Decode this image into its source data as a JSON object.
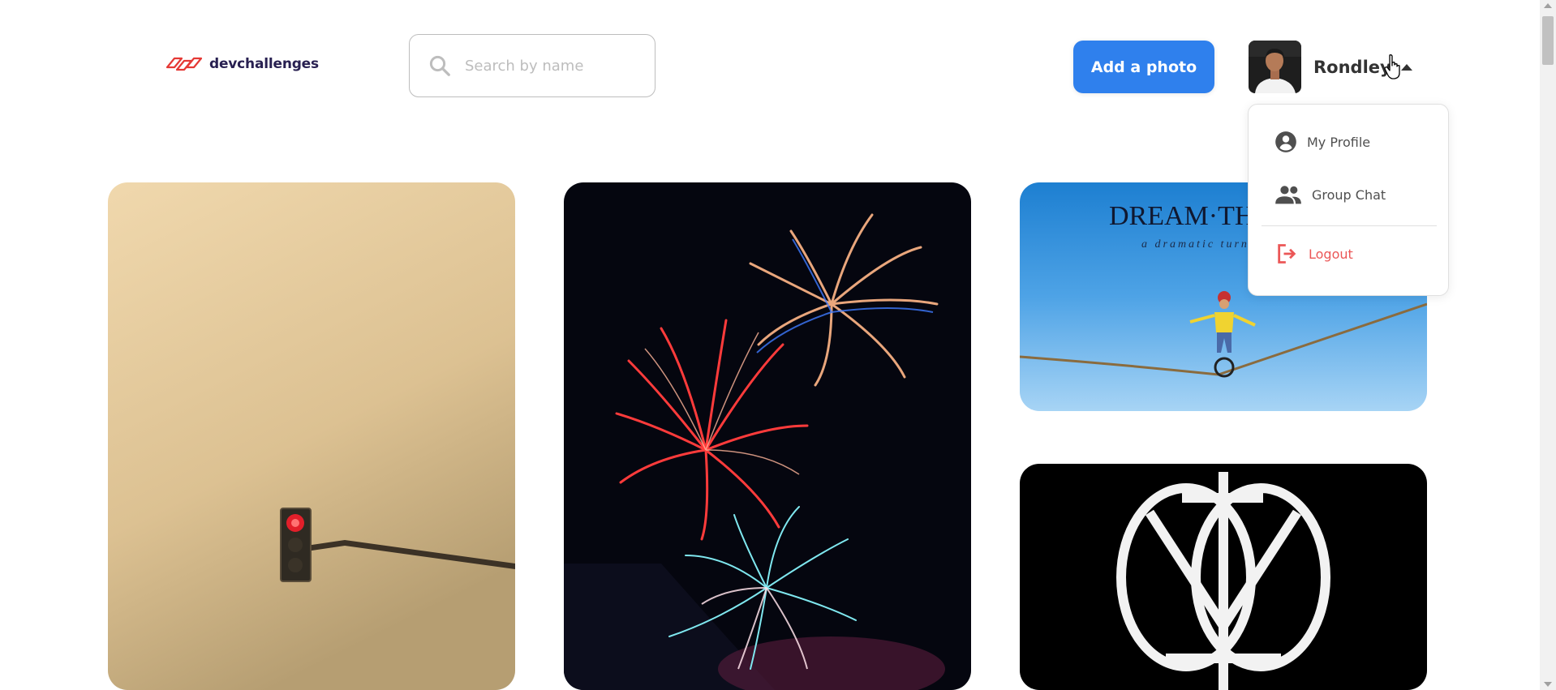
{
  "brand": {
    "name": "devchallenges"
  },
  "search": {
    "placeholder": "Search by name",
    "value": ""
  },
  "header": {
    "add_photo_label": "Add a photo"
  },
  "user": {
    "name": "Rondley"
  },
  "dropdown": {
    "items": [
      {
        "label": "My Profile",
        "icon": "account-circle-icon"
      },
      {
        "label": "Group Chat",
        "icon": "people-icon"
      },
      {
        "label": "Logout",
        "icon": "logout-icon"
      }
    ]
  },
  "gallery": {
    "photos": [
      {
        "subject": "traffic-light"
      },
      {
        "subject": "fireworks"
      },
      {
        "subject": "dream-theater-album-cover",
        "caption_line1": "DREAM·TH",
        "caption_line2": "a dramatic turn"
      },
      {
        "subject": "dream-theater-logo"
      }
    ]
  },
  "colors": {
    "accent": "#2f80ed",
    "logout": "#eb5757",
    "brand_red": "#e53935",
    "brand_text": "#282051"
  }
}
